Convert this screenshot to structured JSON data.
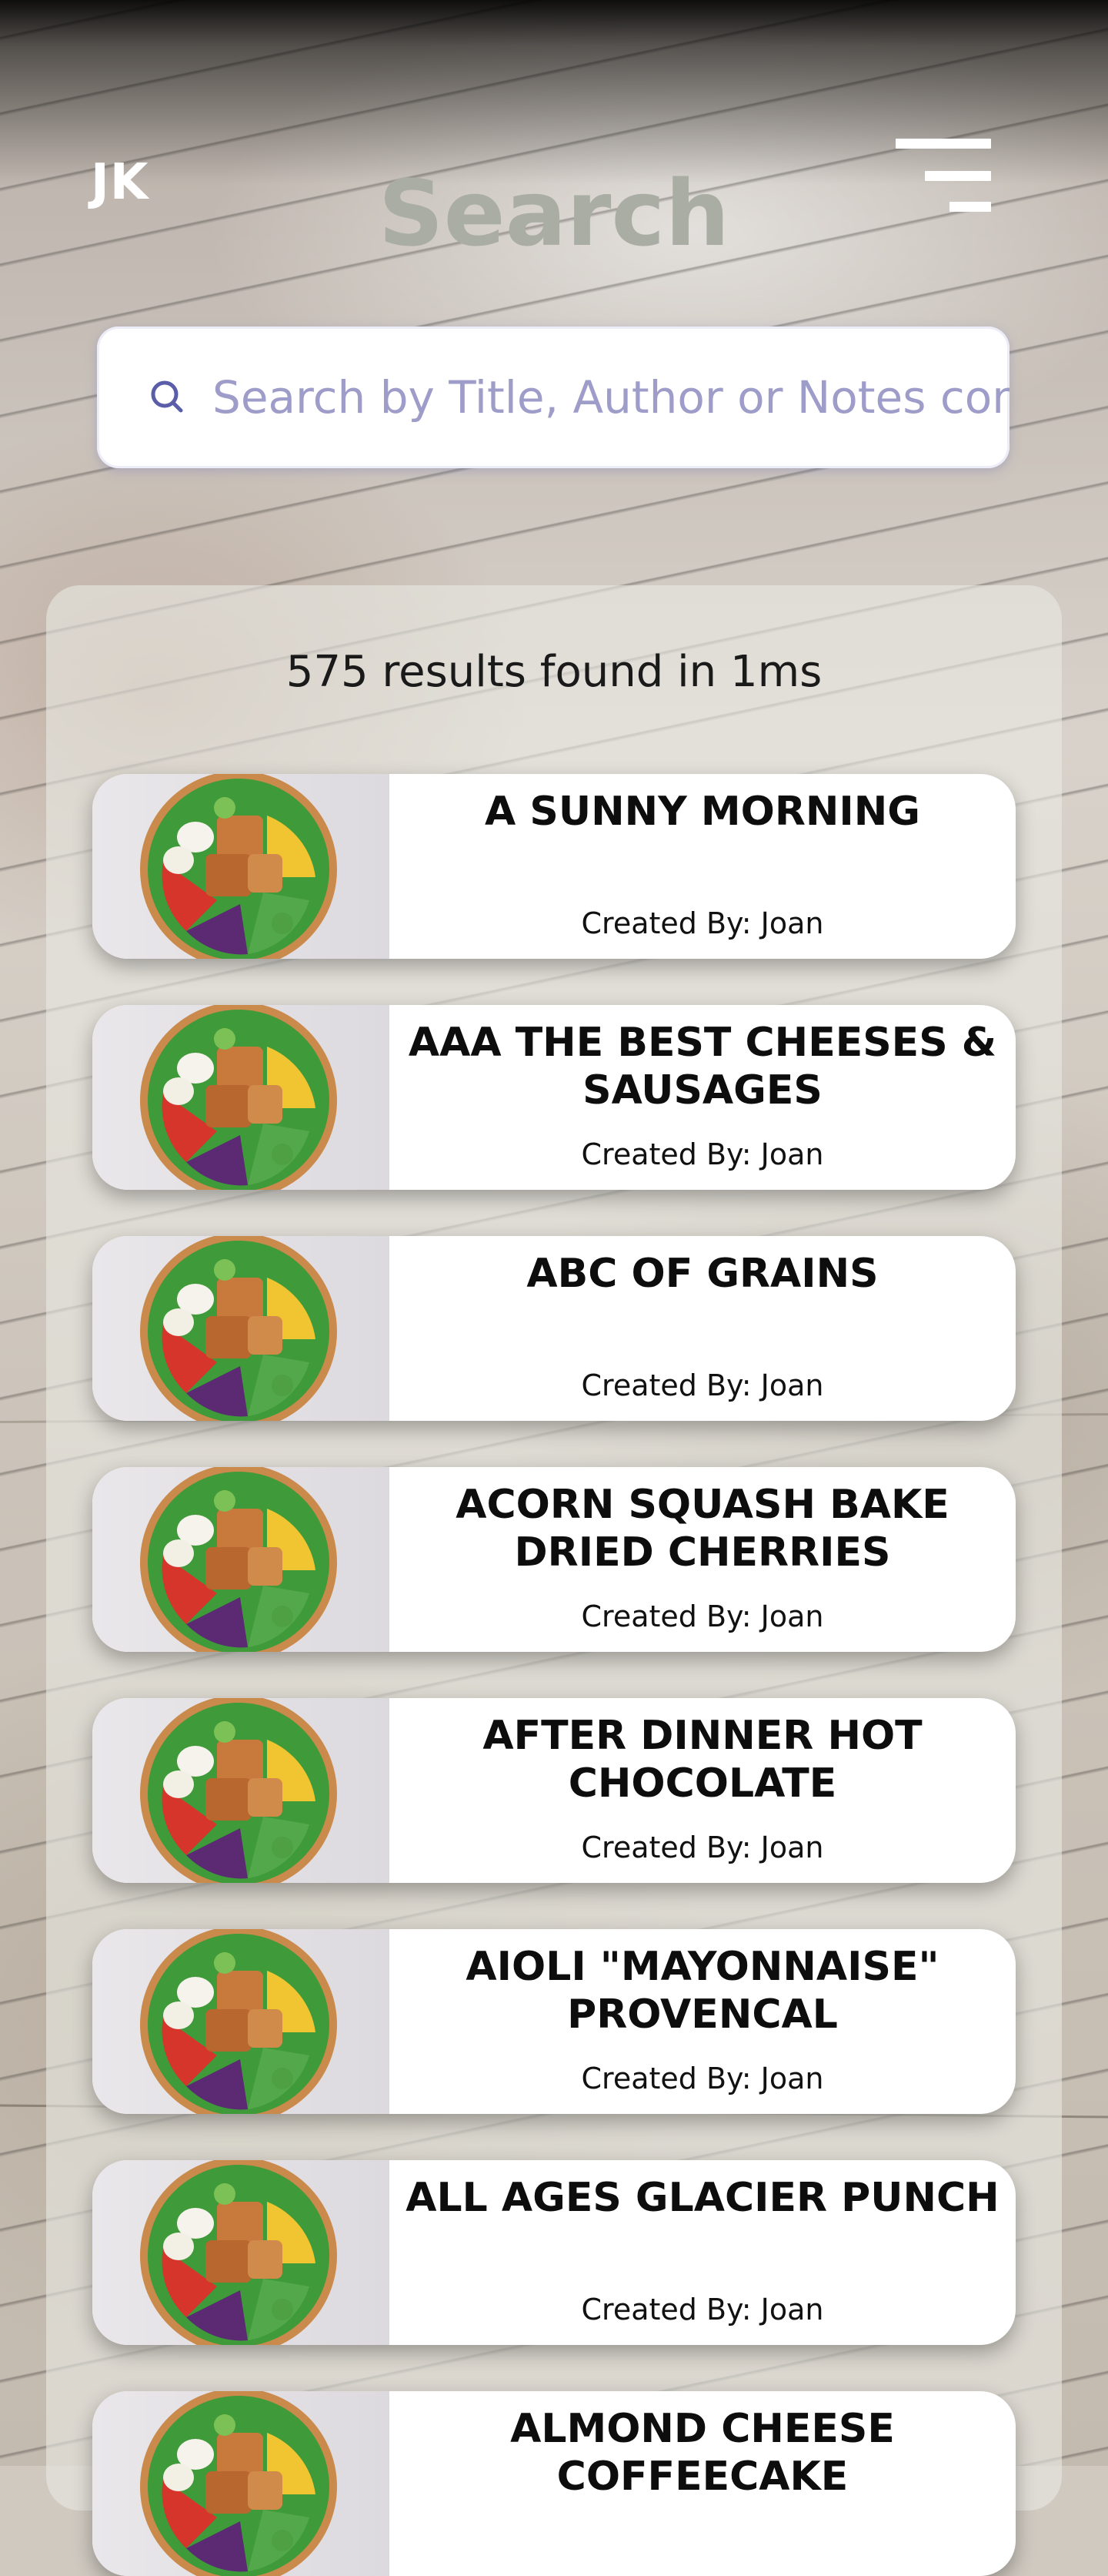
{
  "header": {
    "initials": "JK",
    "title": "Search",
    "menu_icon": "menu-icon"
  },
  "search": {
    "placeholder": "Search by Title, Author or Notes content",
    "value": "",
    "icon": "search-icon"
  },
  "results": {
    "summary": "575 results found in 1ms",
    "items": [
      {
        "title": "A SUNNY MORNING",
        "author": "Created By: Joan"
      },
      {
        "title": "AAA THE BEST CHEESES & SAUSAGES",
        "author": "Created By: Joan"
      },
      {
        "title": "ABC OF GRAINS",
        "author": "Created By: Joan"
      },
      {
        "title": "ACORN SQUASH BAKE DRIED CHERRIES",
        "author": "Created By: Joan"
      },
      {
        "title": "AFTER DINNER HOT CHOCOLATE",
        "author": "Created By: Joan"
      },
      {
        "title": "AIOLI \"MAYONNAISE\" PROVENCAL",
        "author": "Created By: Joan"
      },
      {
        "title": "ALL AGES GLACIER PUNCH",
        "author": "Created By: Joan"
      },
      {
        "title": "ALMOND CHEESE COFFEECAKE",
        "author": ""
      }
    ]
  },
  "colors": {
    "title_gray": "#a9ada4",
    "placeholder": "#9e9cc8",
    "icon_purple": "#5a5ea8"
  }
}
